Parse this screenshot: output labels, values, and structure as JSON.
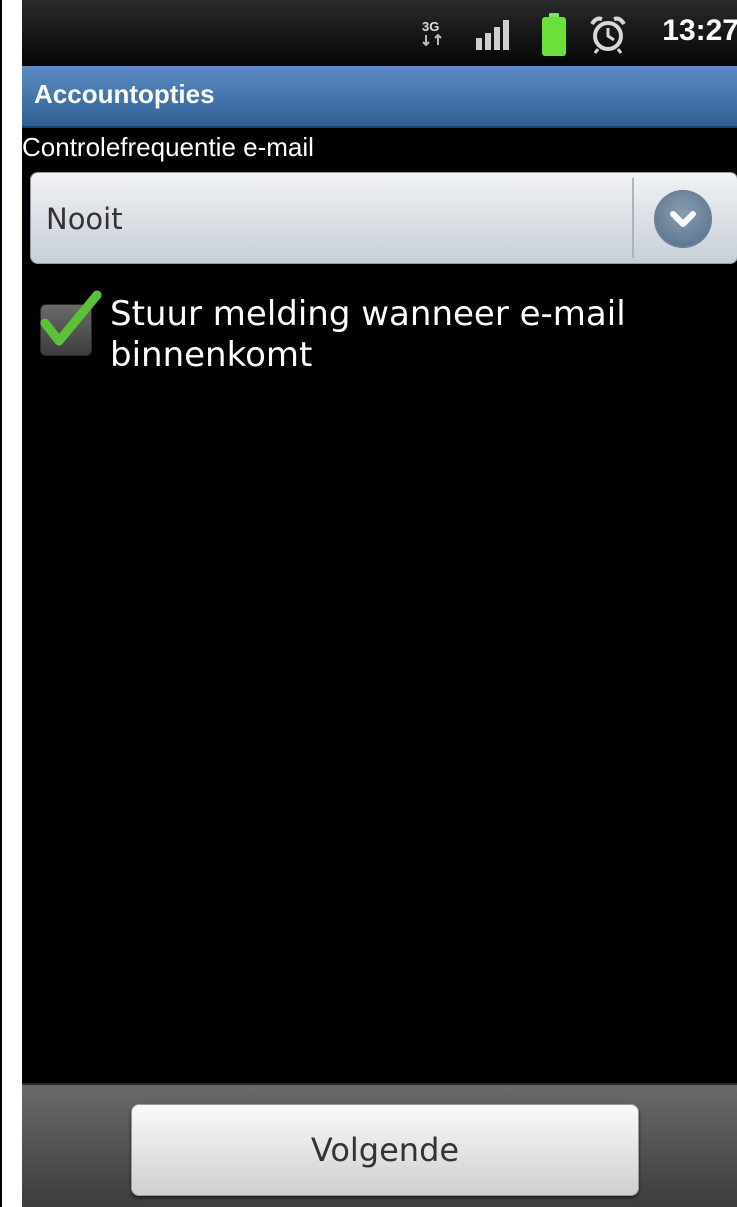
{
  "status_bar": {
    "network_label": "3G",
    "time": "13:27",
    "icons": [
      "network-3g-icon",
      "signal-icon",
      "battery-icon",
      "alarm-icon"
    ]
  },
  "header": {
    "title": "Accountopties"
  },
  "check_frequency": {
    "label": "Controlefrequentie e-mail",
    "selected_value": "Nooit"
  },
  "notification_checkbox": {
    "label": "Stuur melding wanneer e-mail binnenkomt",
    "checked": true
  },
  "footer": {
    "next_label": "Volgende"
  },
  "colors": {
    "accent_blue": "#3e6fa8",
    "check_green": "#5bc236",
    "battery_green": "#6be03a",
    "background": "#000000"
  }
}
